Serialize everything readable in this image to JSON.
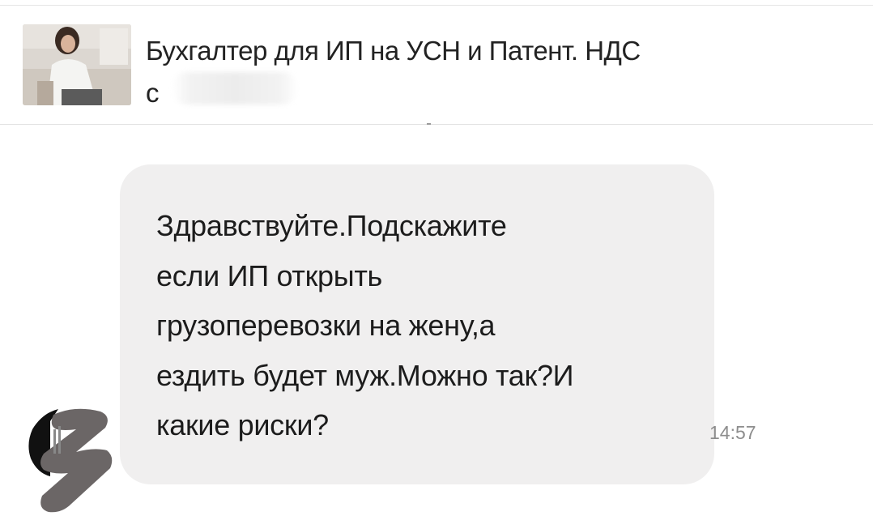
{
  "channel": {
    "title_line1": "Бухгалтер для ИП на УСН и Патент. НДС",
    "title_line2": "с"
  },
  "message": {
    "lines": [
      "Здравствуйте.Подскажите",
      "если ИП открыть",
      "грузоперевозки на жену,а",
      "ездить будет муж.Можно так?И",
      "какие риски?"
    ],
    "time": "14:57"
  },
  "colors": {
    "bubble_bg": "#f0efef",
    "text": "#1c1c1c",
    "timestamp": "#8d8d8d"
  }
}
